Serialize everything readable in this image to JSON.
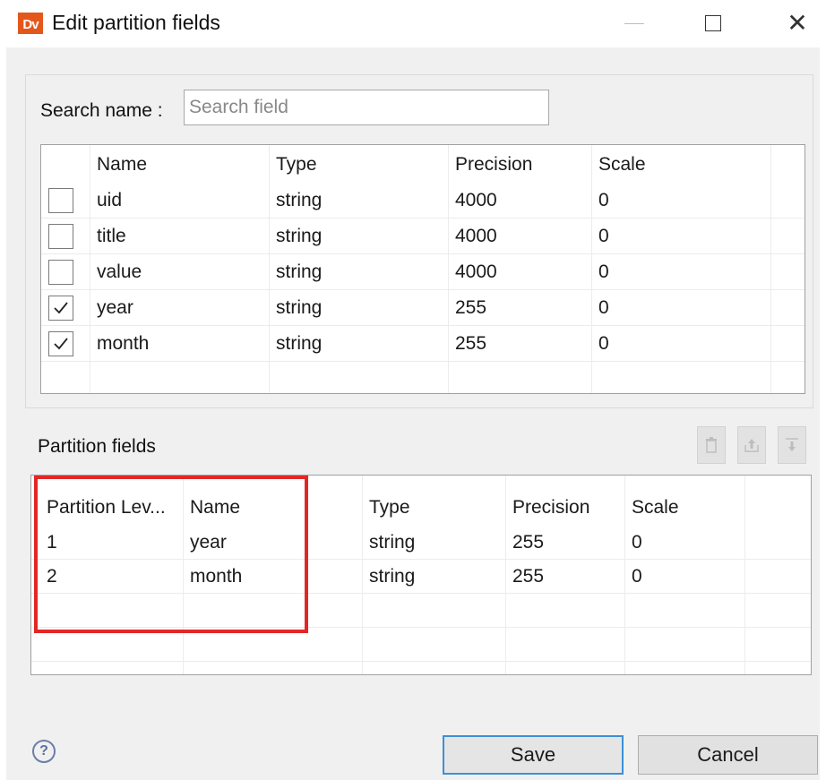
{
  "window": {
    "title": "Edit partition fields",
    "logo_text": "Dv"
  },
  "search": {
    "label": "Search name :",
    "placeholder": "Search field",
    "value": ""
  },
  "fields_table": {
    "columns": [
      "Name",
      "Type",
      "Precision",
      "Scale"
    ],
    "rows": [
      {
        "checked": false,
        "name": "uid",
        "type": "string",
        "precision": "4000",
        "scale": "0"
      },
      {
        "checked": false,
        "name": "title",
        "type": "string",
        "precision": "4000",
        "scale": "0"
      },
      {
        "checked": false,
        "name": "value",
        "type": "string",
        "precision": "4000",
        "scale": "0"
      },
      {
        "checked": true,
        "name": "year",
        "type": "string",
        "precision": "255",
        "scale": "0"
      },
      {
        "checked": true,
        "name": "month",
        "type": "string",
        "precision": "255",
        "scale": "0"
      }
    ]
  },
  "partition": {
    "label": "Partition fields",
    "toolbar_icons": [
      "delete-icon",
      "move-up-icon",
      "move-down-icon"
    ],
    "columns": [
      "Partition Lev...",
      "Name",
      "Type",
      "Precision",
      "Scale"
    ],
    "rows": [
      {
        "level": "1",
        "name": "year",
        "type": "string",
        "precision": "255",
        "scale": "0"
      },
      {
        "level": "2",
        "name": "month",
        "type": "string",
        "precision": "255",
        "scale": "0"
      }
    ]
  },
  "footer": {
    "help_glyph": "?",
    "save_label": "Save",
    "cancel_label": "Cancel"
  },
  "colors": {
    "highlight": "#e32626",
    "logo": "#e4571b",
    "focus": "#3d8fd8"
  }
}
